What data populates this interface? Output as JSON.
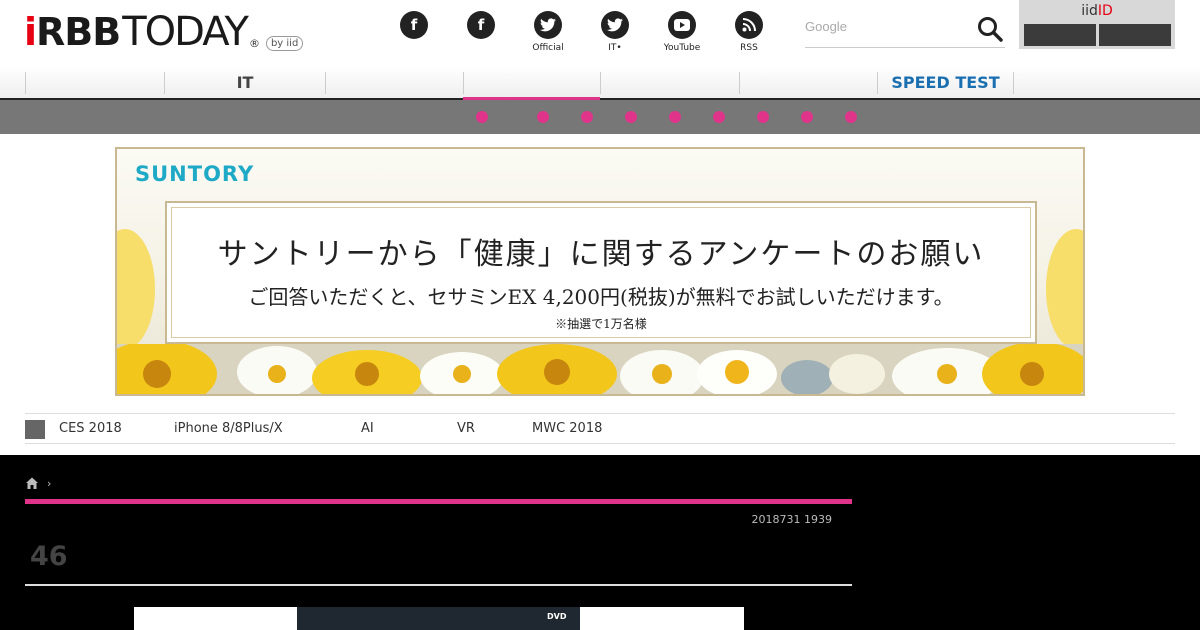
{
  "header": {
    "logo_mark_i": "i",
    "logo_mark_rbb": "RBB",
    "logo_word": "TODAY",
    "logo_reg": "®",
    "byiid": "by iid",
    "social": [
      {
        "icon": "facebook-icon",
        "glyph": "f",
        "label": ""
      },
      {
        "icon": "facebook-icon",
        "glyph": "f",
        "label": ""
      },
      {
        "icon": "twitter-icon",
        "glyph": "🐦",
        "label": "Official"
      },
      {
        "icon": "twitter-icon",
        "glyph": "🐦",
        "label": "IT•"
      },
      {
        "icon": "youtube-icon",
        "glyph": "▶",
        "label": "YouTube"
      },
      {
        "icon": "rss-icon",
        "glyph": "◉",
        "label": "RSS"
      }
    ],
    "search_placeholder": "Google",
    "iid_prefix": "iid",
    "iid_suffix": "ID",
    "accent": "#e60012"
  },
  "nav": {
    "items": [
      "",
      "IT",
      "",
      "",
      "",
      "",
      "SPEED TEST"
    ],
    "accent": "#e0348a",
    "speed_color": "#1a6fb0"
  },
  "banner": {
    "brand": "SUNTORY",
    "headline": "サントリーから「健康」に関するアンケートのお願い",
    "subline": "ご回答いただくと、セサミンEX 4,200円(税抜)が無料でお試しいただけます。",
    "note": "※抽選で1万名様"
  },
  "tags": [
    "CES 2018",
    "iPhone 8/8Plus/X",
    "AI",
    "VR",
    "MWC 2018"
  ],
  "article": {
    "breadcrumb_sep": "›",
    "date": "2018731 1939",
    "title": "46",
    "image_badge": "DVD"
  }
}
